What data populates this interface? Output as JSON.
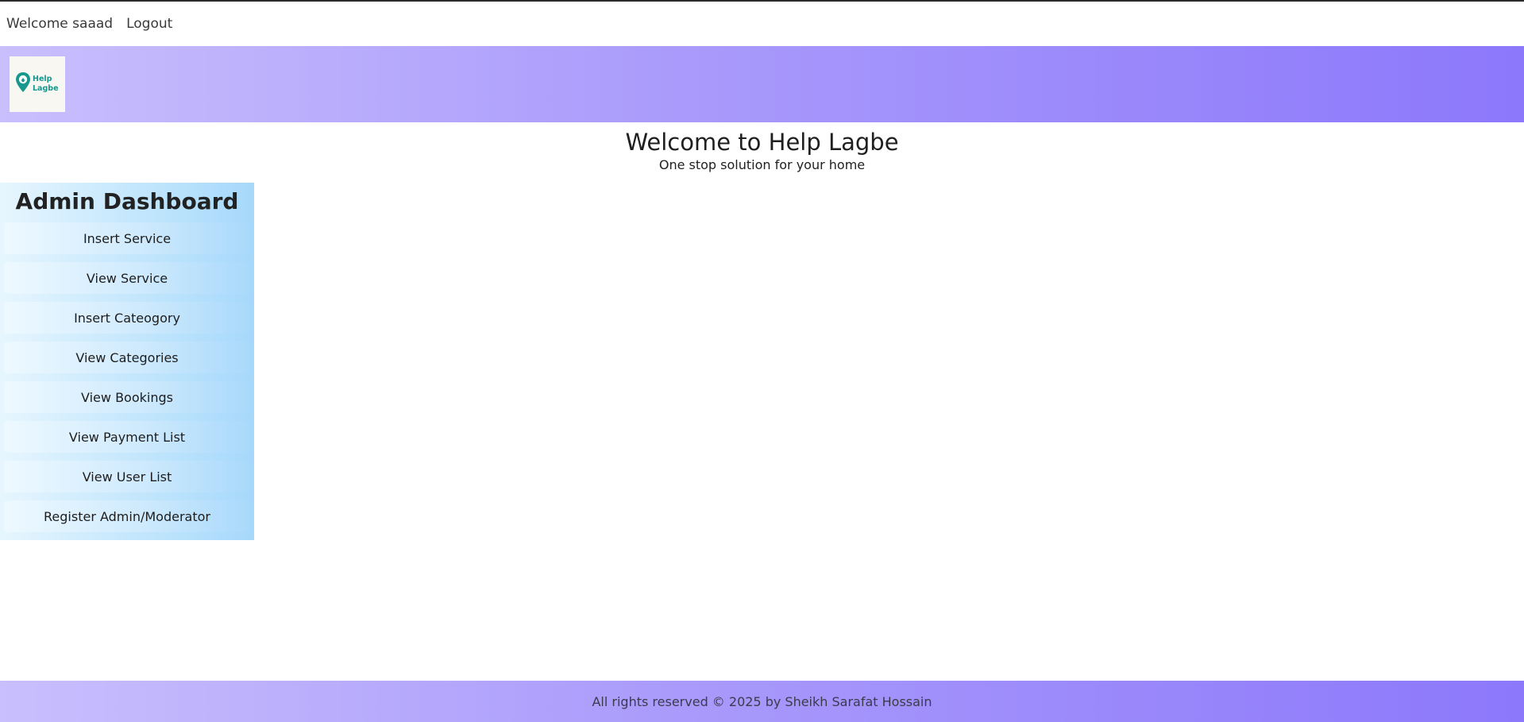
{
  "topbar": {
    "welcome_text": "Welcome saaad",
    "logout_label": "Logout"
  },
  "brand": {
    "logo_line1": "Help",
    "logo_line2": "Lagbe",
    "logo_icon": "location-pin-icon"
  },
  "hero": {
    "title": "Welcome to Help Lagbe",
    "subtitle": "One stop solution for your home"
  },
  "sidebar": {
    "title": "Admin Dashboard",
    "items": [
      {
        "label": "Insert Service"
      },
      {
        "label": "View Service"
      },
      {
        "label": "Insert Cateogory"
      },
      {
        "label": "View Categories"
      },
      {
        "label": "View Bookings"
      },
      {
        "label": "View Payment List"
      },
      {
        "label": "View User List"
      },
      {
        "label": "Register Admin/Moderator"
      }
    ]
  },
  "footer": {
    "text": "All rights reserved © 2025 by Sheikh Sarafat Hossain"
  },
  "colors": {
    "header_gradient_start": "#c9bffd",
    "header_gradient_end": "#8c78fb",
    "sidebar_gradient_start": "#e7f6fe",
    "sidebar_gradient_end": "#a6d8fb",
    "logo_teal": "#17988f"
  }
}
